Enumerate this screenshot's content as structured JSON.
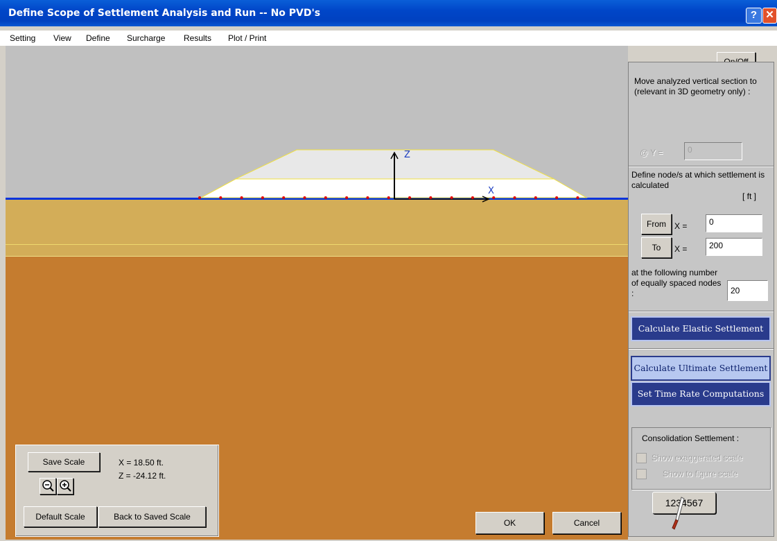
{
  "window": {
    "title": "Define Scope of Settlement Analysis and Run -- No PVD's",
    "help_glyph": "?",
    "close_glyph": "✕"
  },
  "menu": {
    "items": [
      "Setting",
      "View",
      "Define",
      "Surcharge",
      "Results",
      "Plot / Print"
    ]
  },
  "canvas": {
    "axis_z_label": "Z",
    "axis_x_label": "X",
    "colors": {
      "sky": "#c0c0c0",
      "sand_layer": "#d3ad58",
      "clay_layer": "#c57c2f",
      "ground_line": "#0033dd",
      "node_marker": "#e00000",
      "embankment_outline": "#f0e040"
    }
  },
  "scale_panel": {
    "save_scale": "Save Scale",
    "x_readout": "X = 18.50 ft.",
    "z_readout": "Z = -24.12 ft.",
    "default_scale": "Default Scale",
    "back_to_saved": "Back to Saved Scale"
  },
  "dialog_buttons": {
    "ok": "OK",
    "cancel": "Cancel"
  },
  "side_panel": {
    "onoff": "On/Off",
    "move_section_text": "Move analyzed vertical section to (relevant in 3D geometry only) :",
    "y_label": "@ Y =",
    "y_value": "0",
    "define_nodes_text": "Define node/s at which settlement is calculated",
    "units": "[ ft ]",
    "from_label": "From",
    "to_label": "To",
    "x_eq": "X =",
    "from_value": "0",
    "to_value": "200",
    "nodes_text": "at the following number of equally spaced nodes :",
    "nodes_value": "20",
    "calc_elastic": "Calculate  Elastic  Settlement",
    "calc_ultimate": "Calculate  Ultimate  Settlement",
    "set_time_rate": "Set  Time  Rate  Computations",
    "consolidation_title": "Consolidation Settlement :",
    "show_exaggerated": "Show exaggerated scale",
    "show_figure": "Show to figure scale",
    "counter": "1234567"
  }
}
